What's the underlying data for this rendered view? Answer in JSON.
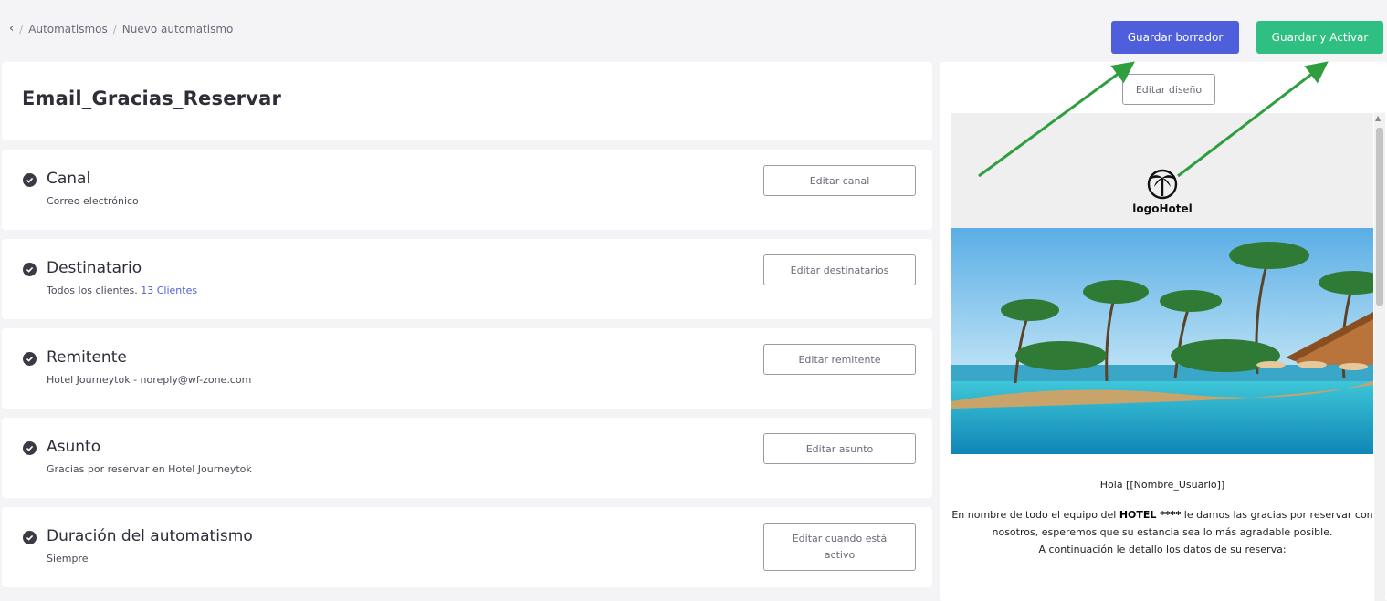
{
  "breadcrumb": {
    "back_icon": "chevron-left-icon",
    "items": [
      "Automatismos",
      "Nuevo automatismo"
    ],
    "separator": "/"
  },
  "header_actions": {
    "save_draft": "Guardar borrador",
    "save_activate": "Guardar y Activar"
  },
  "automation_title": "Email_Gracias_Reservar",
  "sections": [
    {
      "title": "Canal",
      "subtitle": "Correo electrónico",
      "button": "Editar canal"
    },
    {
      "title": "Destinatario",
      "subtitle": "Todos los clientes.",
      "subtitle_link": "13 Clientes",
      "button": "Editar destinatarios"
    },
    {
      "title": "Remitente",
      "subtitle": "Hotel Journeytok - noreply@wf-zone.com",
      "button": "Editar remitente"
    },
    {
      "title": "Asunto",
      "subtitle": "Gracias por reservar en Hotel Journeytok",
      "button": "Editar asunto"
    },
    {
      "title": "Duración del automatismo",
      "subtitle": "Siempre",
      "button": "Editar cuando está activo"
    }
  ],
  "preview": {
    "edit_design": "Editar diseño",
    "logo_text": "logoHotel",
    "logo_icon": "palm-tree-icon",
    "greeting": "Hola [[Nombre_Usuario]]",
    "body_pre": "En nombre de todo el equipo del",
    "body_bold": "HOTEL ****",
    "body_post": "le damos las gracias por reservar con nosotros, esperemos que su estancia sea lo más agradable posible.",
    "body_line2": "A continuación le detallo los datos de su reserva:"
  },
  "colors": {
    "primary": "#4f5fdb",
    "success": "#2fbf83",
    "annotation_arrow": "#2e9e3f"
  }
}
